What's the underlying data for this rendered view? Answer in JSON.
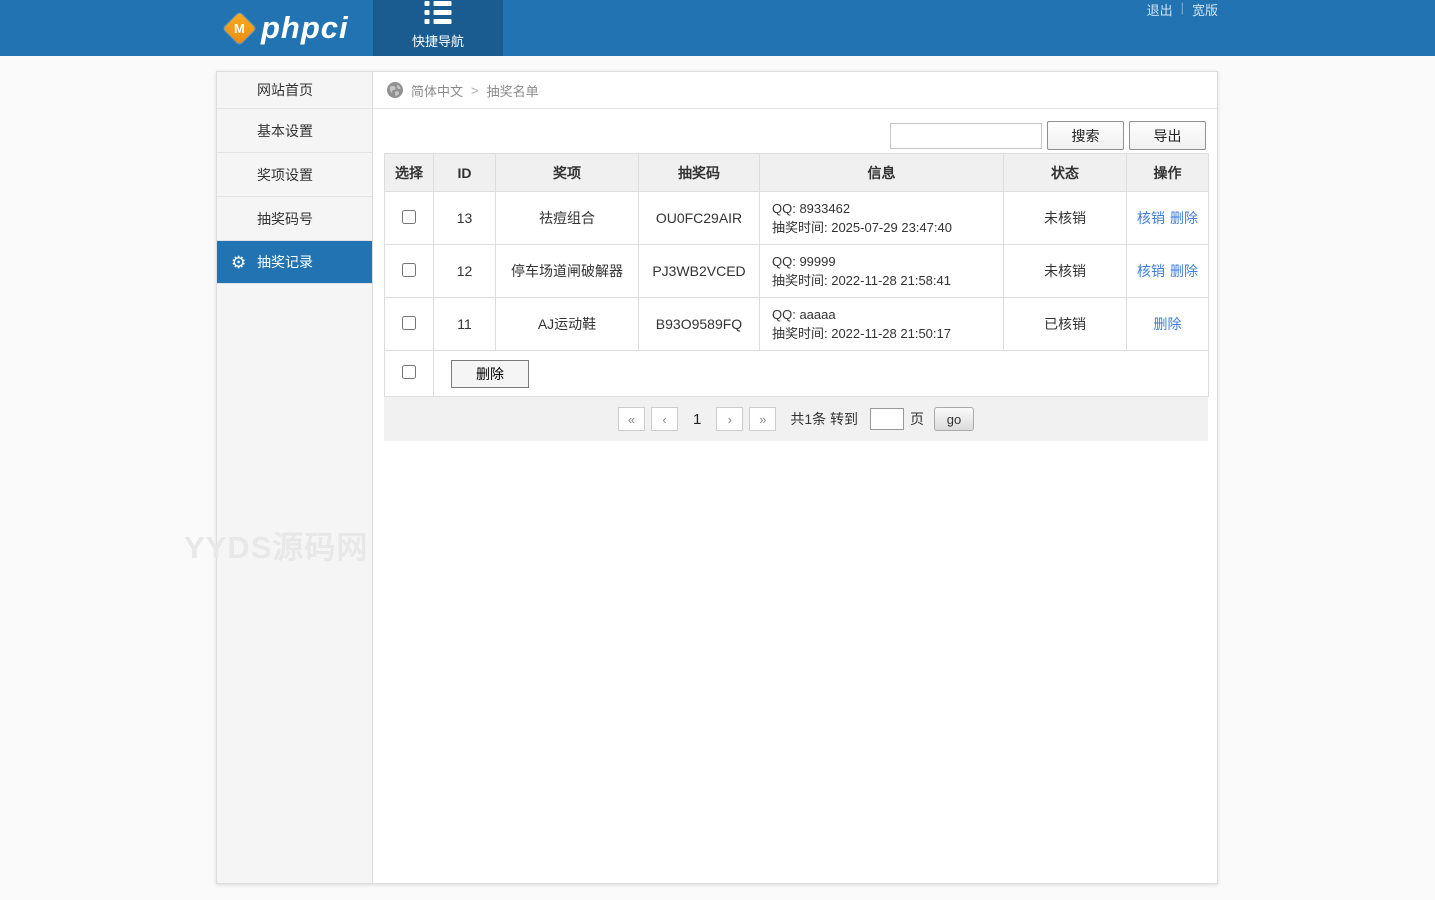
{
  "header": {
    "brand": "phpci",
    "brand_badge": "M",
    "nav_tab_label": "快捷导航",
    "link_logout": "退出",
    "link_sep": "|",
    "link_wide": "宽版"
  },
  "sidebar": {
    "items": [
      {
        "label": "网站首页"
      },
      {
        "label": "基本设置"
      },
      {
        "label": "奖项设置"
      },
      {
        "label": "抽奖码号"
      },
      {
        "label": "抽奖记录",
        "active": true
      }
    ]
  },
  "watermark": "YYDS源码网",
  "breadcrumb": {
    "lang": "简体中文",
    "separator": ">",
    "current": "抽奖名单"
  },
  "toolbar": {
    "search_value": "",
    "search_label": "搜索",
    "export_label": "导出"
  },
  "table": {
    "headers": {
      "select": "选择",
      "id": "ID",
      "prize": "奖项",
      "code": "抽奖码",
      "info": "信息",
      "status": "状态",
      "action": "操作"
    },
    "rows": [
      {
        "id": "13",
        "prize": "祛痘组合",
        "code": "OU0FC29AIR",
        "qq_line": "QQ: 8933462",
        "time_line": "抽奖时间: 2025-07-29 23:47:40",
        "status": "未核销",
        "action_verify": "核销",
        "action_delete": "删除"
      },
      {
        "id": "12",
        "prize": "停车场道闸破解器",
        "code": "PJ3WB2VCED",
        "qq_line": "QQ: 99999",
        "time_line": "抽奖时间: 2022-11-28 21:58:41",
        "status": "未核销",
        "action_verify": "核销",
        "action_delete": "删除"
      },
      {
        "id": "11",
        "prize": "AJ运动鞋",
        "code": "B93O9589FQ",
        "qq_line": "QQ: aaaaa",
        "time_line": "抽奖时间: 2022-11-28 21:50:17",
        "status": "已核销",
        "action_delete": "删除"
      }
    ],
    "batch_delete_label": "删除"
  },
  "pagination": {
    "first": "«",
    "prev": "‹",
    "current": "1",
    "next": "›",
    "last": "»",
    "total_text": "共1条 转到",
    "goto_value": "",
    "page_suffix": "页",
    "go_label": "go"
  },
  "colors": {
    "header_blue": "#2173b2",
    "tab_dark_blue": "#1a5b90",
    "brand_orange": "#f5a01f",
    "link_blue": "#3e7fd9"
  }
}
